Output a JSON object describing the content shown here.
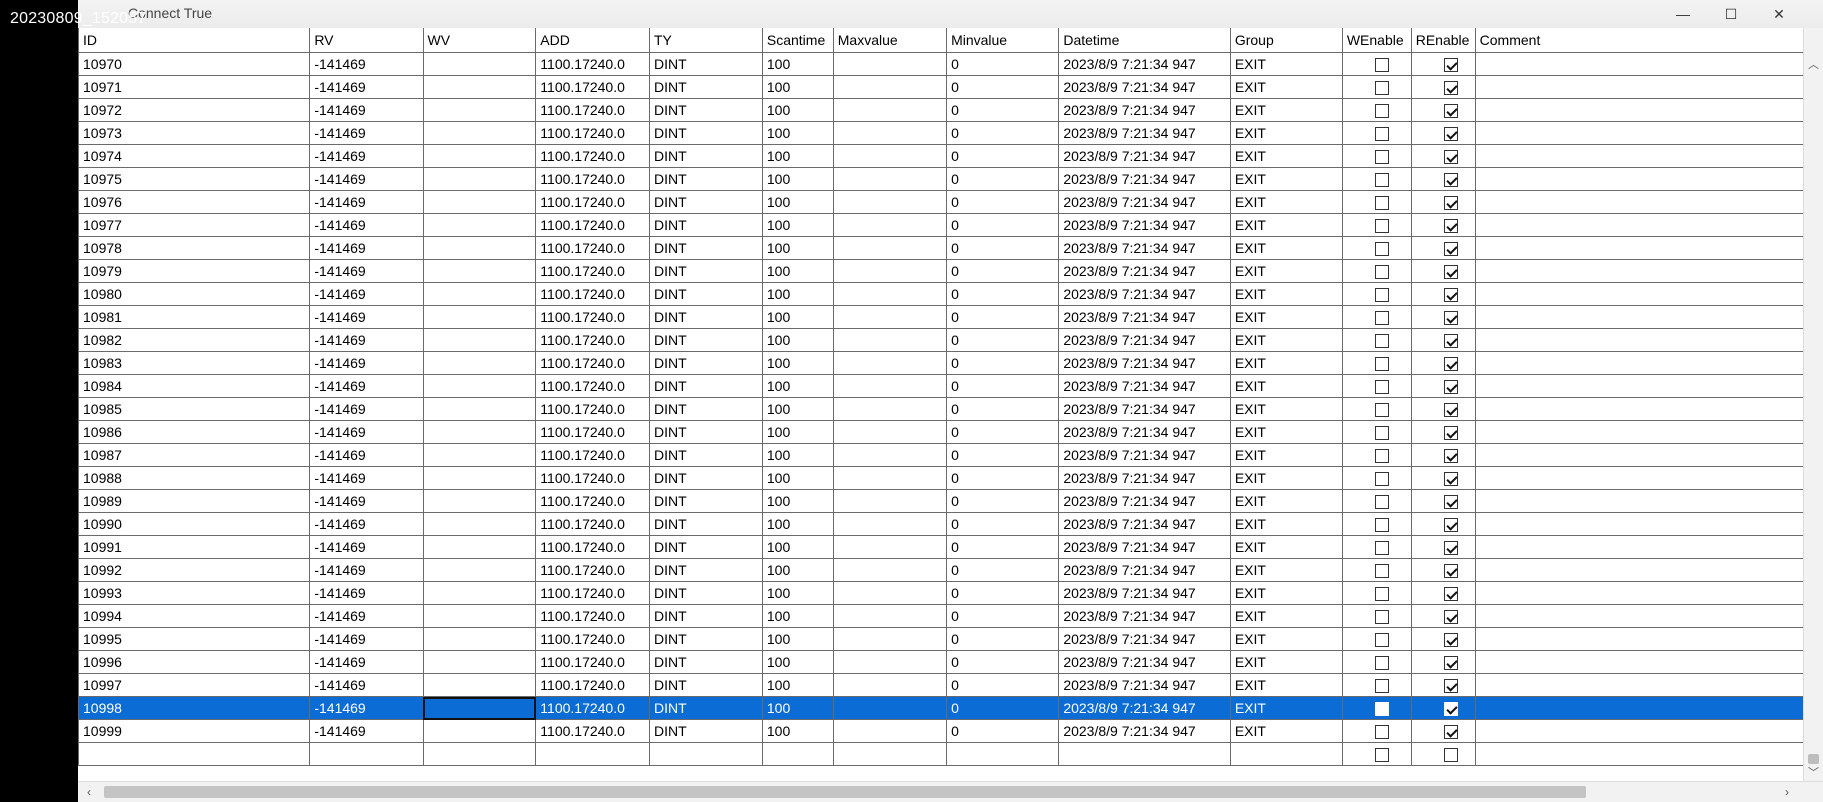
{
  "screenshot_label": "20230809_152057",
  "window": {
    "title": "Connect True",
    "controls": {
      "minimize": "—",
      "maximize": "☐",
      "close": "✕"
    }
  },
  "table": {
    "columns": [
      "ID",
      "RV",
      "WV",
      "ADD",
      "TY",
      "Scantime",
      "Maxvalue",
      "Minvalue",
      "Datetime",
      "Group",
      "WEnable",
      "REnable",
      "Comment"
    ],
    "rows": [
      {
        "id": "10970",
        "rv": "-141469",
        "wv": "",
        "add": "1100.17240.0",
        "ty": "DINT",
        "scantime": "100",
        "maxvalue": "",
        "minvalue": "0",
        "datetime": "2023/8/9 7:21:34 947",
        "group": "EXIT",
        "wenable": false,
        "renable": true,
        "comment": ""
      },
      {
        "id": "10971",
        "rv": "-141469",
        "wv": "",
        "add": "1100.17240.0",
        "ty": "DINT",
        "scantime": "100",
        "maxvalue": "",
        "minvalue": "0",
        "datetime": "2023/8/9 7:21:34 947",
        "group": "EXIT",
        "wenable": false,
        "renable": true,
        "comment": ""
      },
      {
        "id": "10972",
        "rv": "-141469",
        "wv": "",
        "add": "1100.17240.0",
        "ty": "DINT",
        "scantime": "100",
        "maxvalue": "",
        "minvalue": "0",
        "datetime": "2023/8/9 7:21:34 947",
        "group": "EXIT",
        "wenable": false,
        "renable": true,
        "comment": ""
      },
      {
        "id": "10973",
        "rv": "-141469",
        "wv": "",
        "add": "1100.17240.0",
        "ty": "DINT",
        "scantime": "100",
        "maxvalue": "",
        "minvalue": "0",
        "datetime": "2023/8/9 7:21:34 947",
        "group": "EXIT",
        "wenable": false,
        "renable": true,
        "comment": ""
      },
      {
        "id": "10974",
        "rv": "-141469",
        "wv": "",
        "add": "1100.17240.0",
        "ty": "DINT",
        "scantime": "100",
        "maxvalue": "",
        "minvalue": "0",
        "datetime": "2023/8/9 7:21:34 947",
        "group": "EXIT",
        "wenable": false,
        "renable": true,
        "comment": ""
      },
      {
        "id": "10975",
        "rv": "-141469",
        "wv": "",
        "add": "1100.17240.0",
        "ty": "DINT",
        "scantime": "100",
        "maxvalue": "",
        "minvalue": "0",
        "datetime": "2023/8/9 7:21:34 947",
        "group": "EXIT",
        "wenable": false,
        "renable": true,
        "comment": ""
      },
      {
        "id": "10976",
        "rv": "-141469",
        "wv": "",
        "add": "1100.17240.0",
        "ty": "DINT",
        "scantime": "100",
        "maxvalue": "",
        "minvalue": "0",
        "datetime": "2023/8/9 7:21:34 947",
        "group": "EXIT",
        "wenable": false,
        "renable": true,
        "comment": ""
      },
      {
        "id": "10977",
        "rv": "-141469",
        "wv": "",
        "add": "1100.17240.0",
        "ty": "DINT",
        "scantime": "100",
        "maxvalue": "",
        "minvalue": "0",
        "datetime": "2023/8/9 7:21:34 947",
        "group": "EXIT",
        "wenable": false,
        "renable": true,
        "comment": ""
      },
      {
        "id": "10978",
        "rv": "-141469",
        "wv": "",
        "add": "1100.17240.0",
        "ty": "DINT",
        "scantime": "100",
        "maxvalue": "",
        "minvalue": "0",
        "datetime": "2023/8/9 7:21:34 947",
        "group": "EXIT",
        "wenable": false,
        "renable": true,
        "comment": ""
      },
      {
        "id": "10979",
        "rv": "-141469",
        "wv": "",
        "add": "1100.17240.0",
        "ty": "DINT",
        "scantime": "100",
        "maxvalue": "",
        "minvalue": "0",
        "datetime": "2023/8/9 7:21:34 947",
        "group": "EXIT",
        "wenable": false,
        "renable": true,
        "comment": ""
      },
      {
        "id": "10980",
        "rv": "-141469",
        "wv": "",
        "add": "1100.17240.0",
        "ty": "DINT",
        "scantime": "100",
        "maxvalue": "",
        "minvalue": "0",
        "datetime": "2023/8/9 7:21:34 947",
        "group": "EXIT",
        "wenable": false,
        "renable": true,
        "comment": ""
      },
      {
        "id": "10981",
        "rv": "-141469",
        "wv": "",
        "add": "1100.17240.0",
        "ty": "DINT",
        "scantime": "100",
        "maxvalue": "",
        "minvalue": "0",
        "datetime": "2023/8/9 7:21:34 947",
        "group": "EXIT",
        "wenable": false,
        "renable": true,
        "comment": ""
      },
      {
        "id": "10982",
        "rv": "-141469",
        "wv": "",
        "add": "1100.17240.0",
        "ty": "DINT",
        "scantime": "100",
        "maxvalue": "",
        "minvalue": "0",
        "datetime": "2023/8/9 7:21:34 947",
        "group": "EXIT",
        "wenable": false,
        "renable": true,
        "comment": ""
      },
      {
        "id": "10983",
        "rv": "-141469",
        "wv": "",
        "add": "1100.17240.0",
        "ty": "DINT",
        "scantime": "100",
        "maxvalue": "",
        "minvalue": "0",
        "datetime": "2023/8/9 7:21:34 947",
        "group": "EXIT",
        "wenable": false,
        "renable": true,
        "comment": ""
      },
      {
        "id": "10984",
        "rv": "-141469",
        "wv": "",
        "add": "1100.17240.0",
        "ty": "DINT",
        "scantime": "100",
        "maxvalue": "",
        "minvalue": "0",
        "datetime": "2023/8/9 7:21:34 947",
        "group": "EXIT",
        "wenable": false,
        "renable": true,
        "comment": ""
      },
      {
        "id": "10985",
        "rv": "-141469",
        "wv": "",
        "add": "1100.17240.0",
        "ty": "DINT",
        "scantime": "100",
        "maxvalue": "",
        "minvalue": "0",
        "datetime": "2023/8/9 7:21:34 947",
        "group": "EXIT",
        "wenable": false,
        "renable": true,
        "comment": ""
      },
      {
        "id": "10986",
        "rv": "-141469",
        "wv": "",
        "add": "1100.17240.0",
        "ty": "DINT",
        "scantime": "100",
        "maxvalue": "",
        "minvalue": "0",
        "datetime": "2023/8/9 7:21:34 947",
        "group": "EXIT",
        "wenable": false,
        "renable": true,
        "comment": ""
      },
      {
        "id": "10987",
        "rv": "-141469",
        "wv": "",
        "add": "1100.17240.0",
        "ty": "DINT",
        "scantime": "100",
        "maxvalue": "",
        "minvalue": "0",
        "datetime": "2023/8/9 7:21:34 947",
        "group": "EXIT",
        "wenable": false,
        "renable": true,
        "comment": ""
      },
      {
        "id": "10988",
        "rv": "-141469",
        "wv": "",
        "add": "1100.17240.0",
        "ty": "DINT",
        "scantime": "100",
        "maxvalue": "",
        "minvalue": "0",
        "datetime": "2023/8/9 7:21:34 947",
        "group": "EXIT",
        "wenable": false,
        "renable": true,
        "comment": ""
      },
      {
        "id": "10989",
        "rv": "-141469",
        "wv": "",
        "add": "1100.17240.0",
        "ty": "DINT",
        "scantime": "100",
        "maxvalue": "",
        "minvalue": "0",
        "datetime": "2023/8/9 7:21:34 947",
        "group": "EXIT",
        "wenable": false,
        "renable": true,
        "comment": ""
      },
      {
        "id": "10990",
        "rv": "-141469",
        "wv": "",
        "add": "1100.17240.0",
        "ty": "DINT",
        "scantime": "100",
        "maxvalue": "",
        "minvalue": "0",
        "datetime": "2023/8/9 7:21:34 947",
        "group": "EXIT",
        "wenable": false,
        "renable": true,
        "comment": ""
      },
      {
        "id": "10991",
        "rv": "-141469",
        "wv": "",
        "add": "1100.17240.0",
        "ty": "DINT",
        "scantime": "100",
        "maxvalue": "",
        "minvalue": "0",
        "datetime": "2023/8/9 7:21:34 947",
        "group": "EXIT",
        "wenable": false,
        "renable": true,
        "comment": ""
      },
      {
        "id": "10992",
        "rv": "-141469",
        "wv": "",
        "add": "1100.17240.0",
        "ty": "DINT",
        "scantime": "100",
        "maxvalue": "",
        "minvalue": "0",
        "datetime": "2023/8/9 7:21:34 947",
        "group": "EXIT",
        "wenable": false,
        "renable": true,
        "comment": ""
      },
      {
        "id": "10993",
        "rv": "-141469",
        "wv": "",
        "add": "1100.17240.0",
        "ty": "DINT",
        "scantime": "100",
        "maxvalue": "",
        "minvalue": "0",
        "datetime": "2023/8/9 7:21:34 947",
        "group": "EXIT",
        "wenable": false,
        "renable": true,
        "comment": ""
      },
      {
        "id": "10994",
        "rv": "-141469",
        "wv": "",
        "add": "1100.17240.0",
        "ty": "DINT",
        "scantime": "100",
        "maxvalue": "",
        "minvalue": "0",
        "datetime": "2023/8/9 7:21:34 947",
        "group": "EXIT",
        "wenable": false,
        "renable": true,
        "comment": ""
      },
      {
        "id": "10995",
        "rv": "-141469",
        "wv": "",
        "add": "1100.17240.0",
        "ty": "DINT",
        "scantime": "100",
        "maxvalue": "",
        "minvalue": "0",
        "datetime": "2023/8/9 7:21:34 947",
        "group": "EXIT",
        "wenable": false,
        "renable": true,
        "comment": ""
      },
      {
        "id": "10996",
        "rv": "-141469",
        "wv": "",
        "add": "1100.17240.0",
        "ty": "DINT",
        "scantime": "100",
        "maxvalue": "",
        "minvalue": "0",
        "datetime": "2023/8/9 7:21:34 947",
        "group": "EXIT",
        "wenable": false,
        "renable": true,
        "comment": ""
      },
      {
        "id": "10997",
        "rv": "-141469",
        "wv": "",
        "add": "1100.17240.0",
        "ty": "DINT",
        "scantime": "100",
        "maxvalue": "",
        "minvalue": "0",
        "datetime": "2023/8/9 7:21:34 947",
        "group": "EXIT",
        "wenable": false,
        "renable": true,
        "comment": ""
      },
      {
        "id": "10998",
        "rv": "-141469",
        "wv": "",
        "add": "1100.17240.0",
        "ty": "DINT",
        "scantime": "100",
        "maxvalue": "",
        "minvalue": "0",
        "datetime": "2023/8/9 7:21:34 947",
        "group": "EXIT",
        "wenable": false,
        "renable": true,
        "comment": "",
        "selected": true
      },
      {
        "id": "10999",
        "rv": "-141469",
        "wv": "",
        "add": "1100.17240.0",
        "ty": "DINT",
        "scantime": "100",
        "maxvalue": "",
        "minvalue": "0",
        "datetime": "2023/8/9 7:21:34 947",
        "group": "EXIT",
        "wenable": false,
        "renable": true,
        "comment": ""
      },
      {
        "id": "",
        "rv": "",
        "wv": "",
        "add": "",
        "ty": "",
        "scantime": "",
        "maxvalue": "",
        "minvalue": "",
        "datetime": "",
        "group": "",
        "wenable": false,
        "renable": false,
        "comment": "",
        "new_row": true
      }
    ]
  },
  "scrollbars": {
    "up_arrow": "︿",
    "down_arrow": "﹀",
    "left_arrow": "‹",
    "right_arrow": "›"
  },
  "colors": {
    "selection": "#0b6cd6",
    "desktop": "#000000",
    "grid_line": "#6a6a6a"
  }
}
